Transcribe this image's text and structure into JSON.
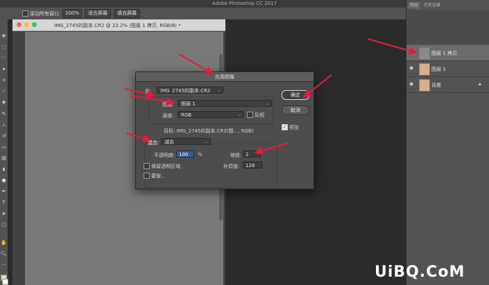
{
  "app": {
    "title": "Adobe Photoshop CC 2017"
  },
  "options_bar": {
    "scroll_all_label": "滚动所有窗口",
    "zoom_100": "100%",
    "fit_screen": "适合屏幕",
    "fill_screen": "填充屏幕"
  },
  "document": {
    "title": "IMG_2745的副本.CR2 @ 23.2% (图层 1 拷贝, RGB/8) *"
  },
  "dialog": {
    "title": "应用图像",
    "source_label": "源:",
    "source_value": "IMG_2745的副本.CR2",
    "layer_label": "图层:",
    "layer_value": "图层 1",
    "channel_label": "通道:",
    "channel_value": "RGB",
    "invert_label": "反相",
    "target_text": "目标: IMG_2745的副本.CR2(图..., RGB)",
    "blend_label": "混合:",
    "blend_value": "减去",
    "opacity_label": "不透明度:",
    "opacity_value": "100",
    "opacity_unit": "%",
    "scale_label": "缩放:",
    "scale_value": "2",
    "preserve_transparency_label": "保留透明区域",
    "offset_label": "补偿值:",
    "offset_value": "128",
    "mask_label": "蒙版...",
    "ok_label": "确定",
    "cancel_label": "取消",
    "preview_label": "预览",
    "preview_checked": true
  },
  "layers_panel": {
    "tabs": [
      "图层",
      "历史记录"
    ],
    "layers": [
      {
        "name": "图层 1 拷贝",
        "selected": true
      },
      {
        "name": "图层 1",
        "selected": false
      },
      {
        "name": "背景",
        "selected": false,
        "locked": true
      }
    ]
  },
  "colors": {
    "annotation_arrow": "#e8193c",
    "ok_button": "#3f3f3f",
    "selection_highlight": "#2f5f9e"
  },
  "watermark": "UiBQ.CoM"
}
